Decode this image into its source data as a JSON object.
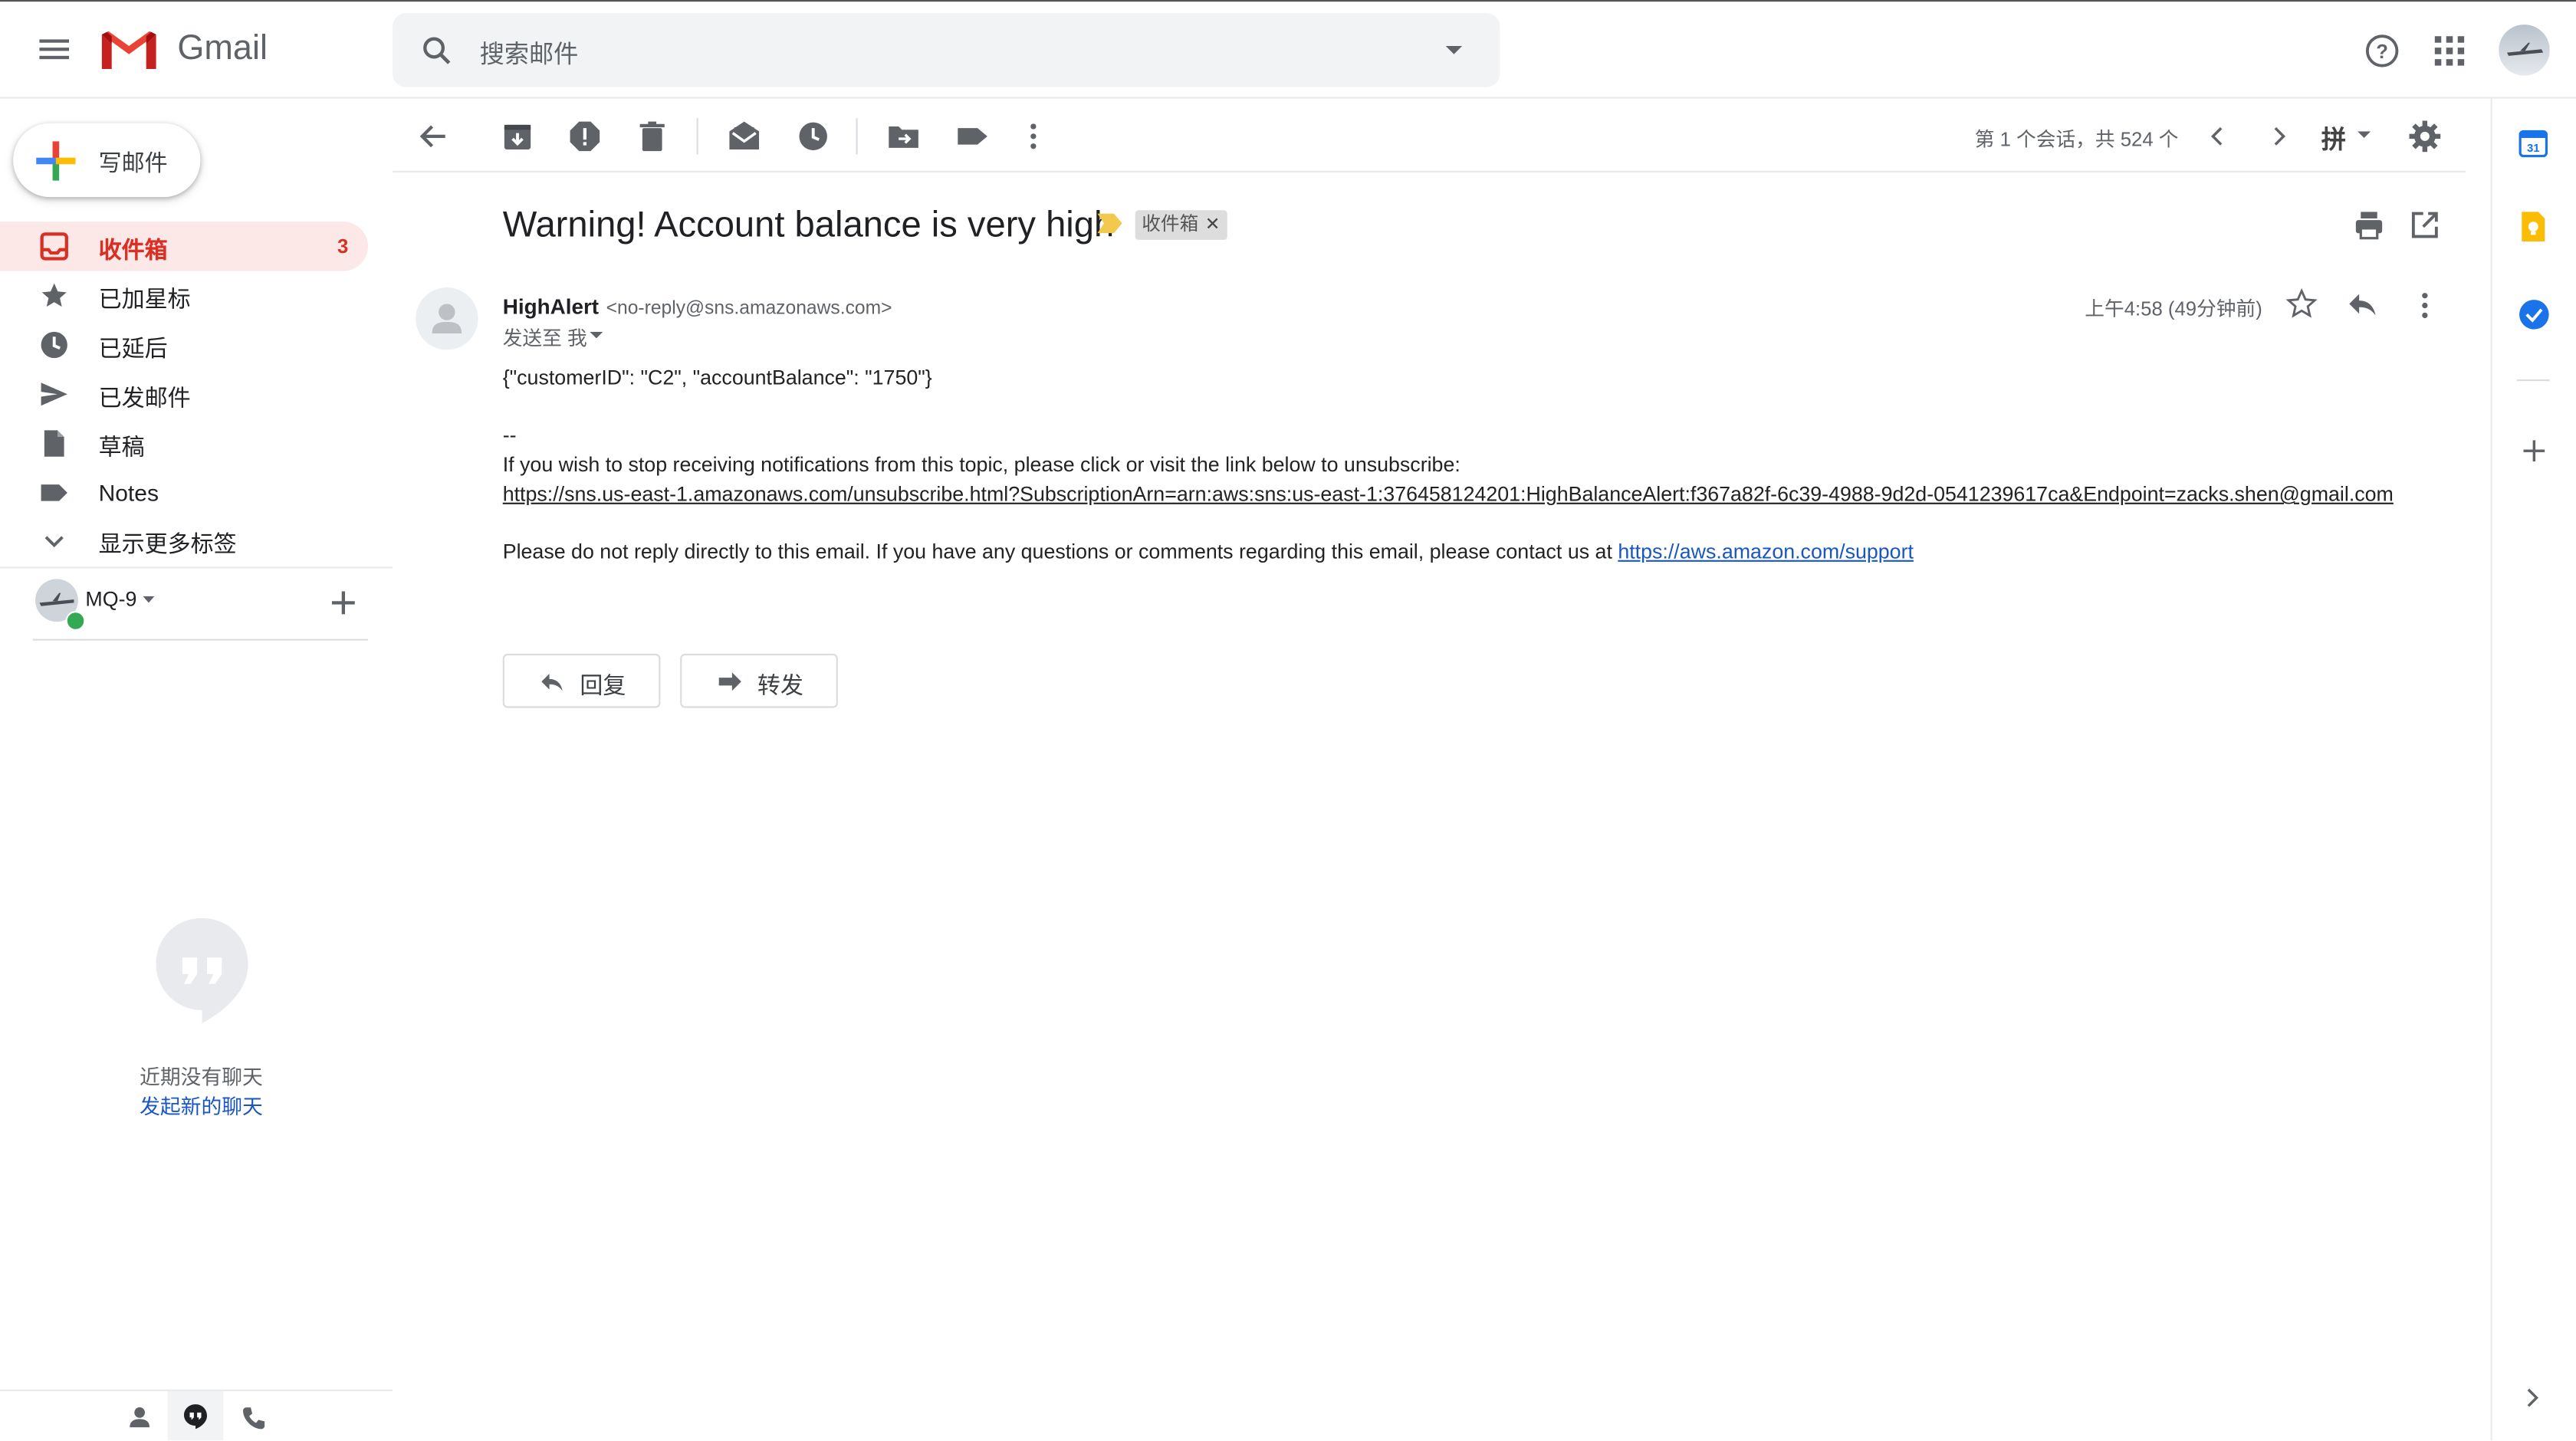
{
  "header": {
    "app_name": "Gmail",
    "search_placeholder": "搜索邮件",
    "icons": [
      "menu-icon",
      "gmail-logo",
      "search-icon",
      "search-options-icon",
      "help-icon",
      "apps-icon",
      "account-avatar"
    ]
  },
  "compose": {
    "label": "写邮件"
  },
  "sidebar": {
    "items": [
      {
        "label": "收件箱",
        "count": "3",
        "icon": "inbox-icon"
      },
      {
        "label": "已加星标",
        "icon": "star-icon"
      },
      {
        "label": "已延后",
        "icon": "clock-icon"
      },
      {
        "label": "已发邮件",
        "icon": "send-icon"
      },
      {
        "label": "草稿",
        "icon": "draft-icon"
      },
      {
        "label": "Notes",
        "icon": "label-icon"
      },
      {
        "label": "显示更多标签",
        "icon": "expand-icon"
      }
    ],
    "hangouts_user": "MQ-9",
    "no_chats": "近期没有聊天",
    "start_chat": "发起新的聊天"
  },
  "toolbar": {
    "pagination": "第 1 个会话，共 524 个",
    "input_tool": "拼"
  },
  "email": {
    "subject": "Warning! Account balance is very high",
    "label_chip": "收件箱",
    "sender_name": "HighAlert",
    "sender_email": "<no-reply@sns.amazonaws.com>",
    "recipient": "发送至 我",
    "time": "上午4:58 (49分钟前)",
    "body_json": "{\"customerID\": \"C2\", \"accountBalance\": \"1750\"}",
    "signature_sep": "--",
    "unsubscribe_text": "If you wish to stop receiving notifications from this topic, please click or visit the link below to unsubscribe:",
    "unsubscribe_link": "https://sns.us-east-1.amazonaws.com/unsubscribe.html?SubscriptionArn=arn:aws:sns:us-east-1:376458124201:HighBalanceAlert:f367a82f-6c39-4988-9d2d-0541239617ca&Endpoint=zacks.shen@gmail.com",
    "noreply_text": "Please do not reply directly to this email. If you have any questions or comments regarding this email, please contact us at ",
    "support_link": "https://aws.amazon.com/support"
  },
  "actions": {
    "reply": "回复",
    "forward": "转发"
  },
  "colors": {
    "accent_red": "#d93025",
    "link_blue": "#1a55c4",
    "active_bg": "#fce8e6",
    "important_marker": "#f2c94c"
  }
}
